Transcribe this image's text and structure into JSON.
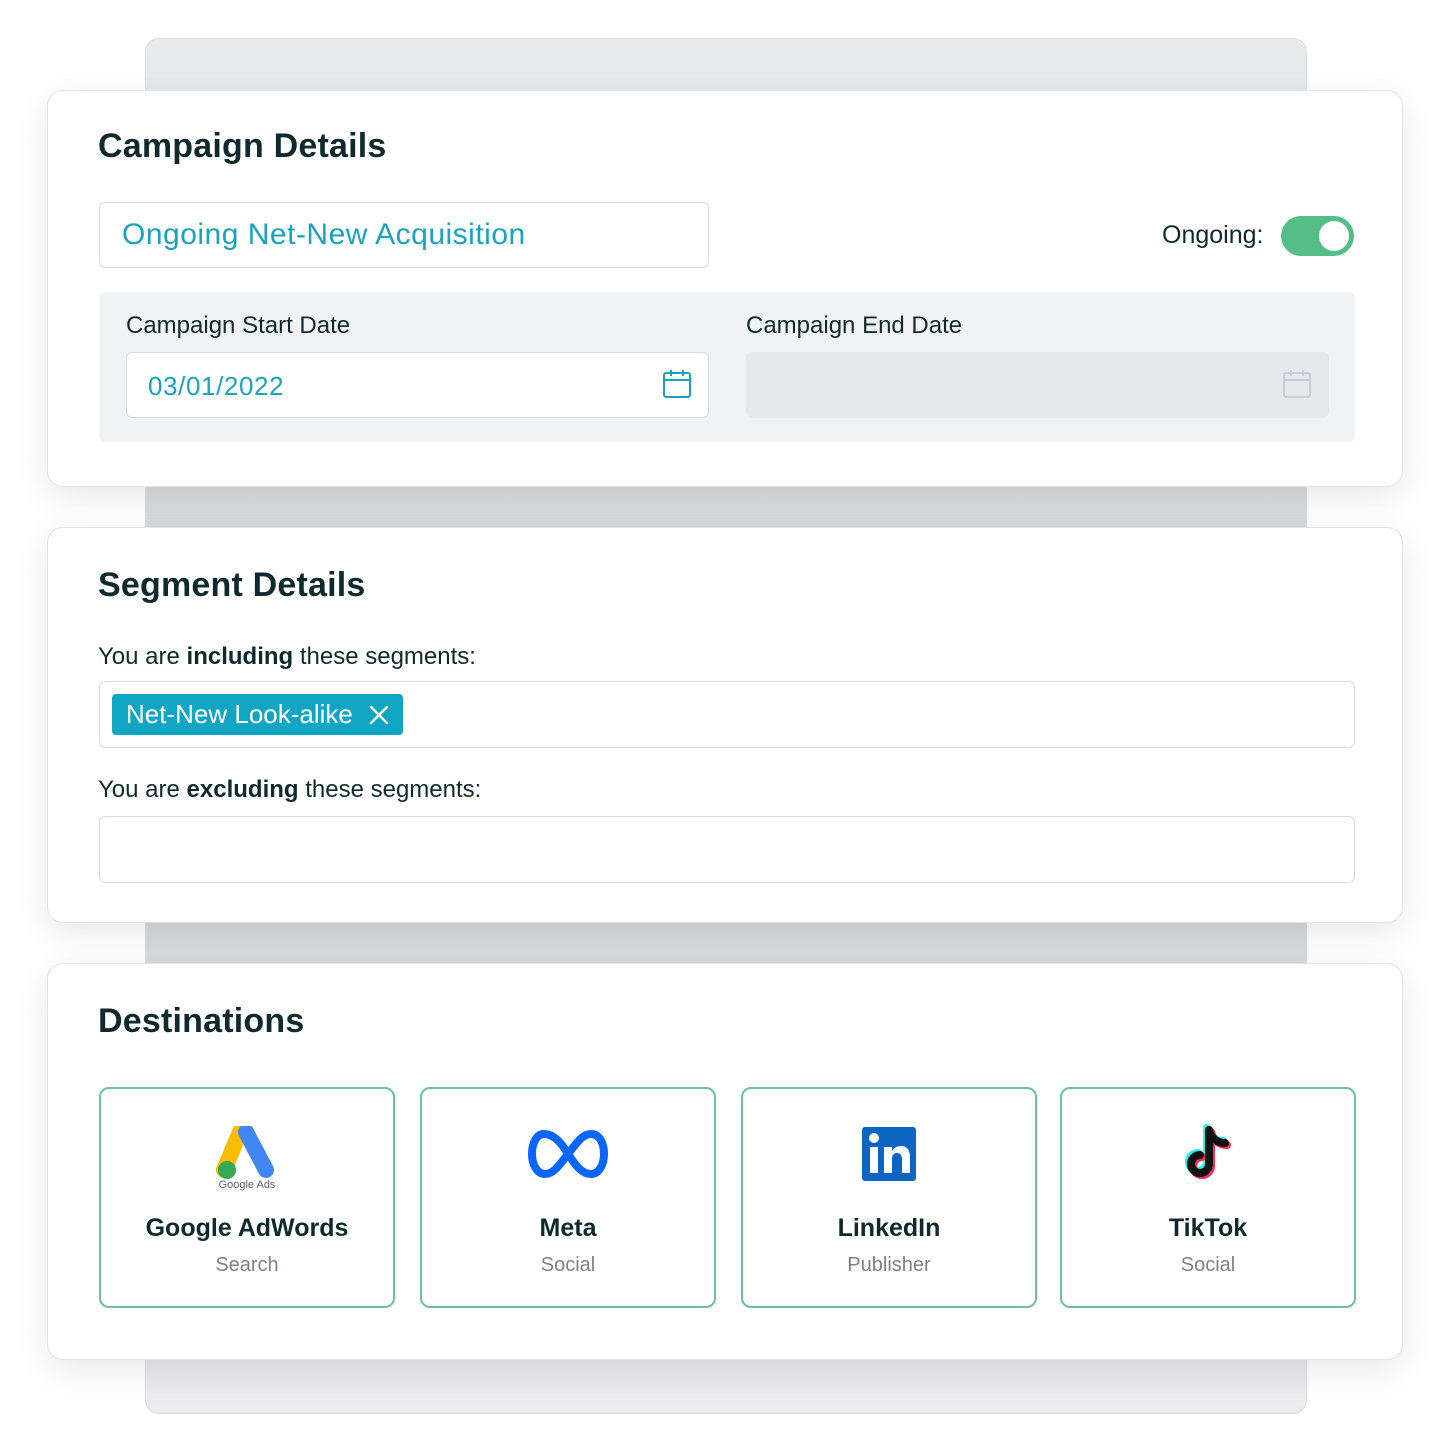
{
  "campaign": {
    "title": "Campaign Details",
    "name_value": "Ongoing Net-New Acquisition",
    "ongoing_label": "Ongoing:",
    "ongoing_on": true,
    "start_label": "Campaign Start Date",
    "start_value": "03/01/2022",
    "end_label": "Campaign End Date",
    "end_value": ""
  },
  "segments": {
    "title": "Segment Details",
    "including_prefix": "You are ",
    "including_bold": "including",
    "including_suffix": " these segments:",
    "included": [
      "Net-New Look-alike"
    ],
    "excluding_prefix": "You are ",
    "excluding_bold": "excluding",
    "excluding_suffix": " these segments:",
    "excluded": []
  },
  "destinations": {
    "title": "Destinations",
    "items": [
      {
        "name": "Google AdWords",
        "type": "Search",
        "icon": "google-ads-icon",
        "logo_caption": "Google Ads"
      },
      {
        "name": "Meta",
        "type": "Social",
        "icon": "meta-icon"
      },
      {
        "name": "LinkedIn",
        "type": "Publisher",
        "icon": "linkedin-icon"
      },
      {
        "name": "TikTok",
        "type": "Social",
        "icon": "tiktok-icon"
      }
    ]
  },
  "colors": {
    "accent_teal": "#10a5c2",
    "toggle_green": "#55bd86",
    "card_border_green": "#6cc197"
  }
}
